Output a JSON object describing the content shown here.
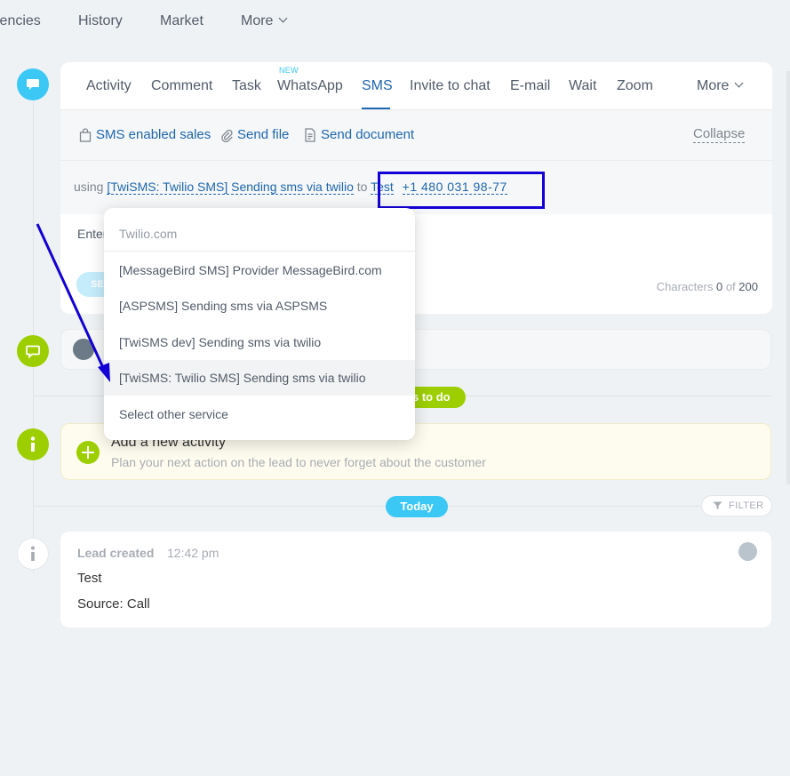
{
  "top_nav": {
    "items": [
      "lencies",
      "History",
      "Market",
      "More"
    ]
  },
  "composer": {
    "tabs": [
      "Activity",
      "Comment",
      "Task",
      "WhatsApp",
      "SMS",
      "Invite to chat",
      "E-mail",
      "Wait",
      "Zoom",
      "More"
    ],
    "new_badge": "NEW",
    "active_tab": "SMS",
    "toolbar": {
      "sms_enabled_sales": "SMS enabled sales",
      "send_file": "Send file",
      "send_document": "Send document",
      "collapse": "Collapse"
    },
    "using": {
      "prefix": "using",
      "service": "[TwiSMS: Twilio SMS] Sending sms via twilio",
      "to": "to",
      "contact": "Test",
      "phone": "+1 480 031 98-77"
    },
    "message_placeholder": "Enter",
    "send_label": "SE",
    "characters": {
      "label": "Characters",
      "count": "0",
      "of": "of",
      "max": "200"
    }
  },
  "service_dropdown": {
    "header": "Twilio.com",
    "items": [
      "[MessageBird SMS] Provider MessageBird.com",
      "[ASPSMS] Sending sms via ASPSMS",
      "[TwiSMS dev] Sending sms via twilio",
      "[TwiSMS: Twilio SMS] Sending sms via twilio",
      "Select other service"
    ],
    "selected": "[TwiSMS: Twilio SMS] Sending sms via twilio"
  },
  "timeline": {
    "todo_badge": "s to do",
    "new_activity": {
      "title": "Add a new activity",
      "subtitle": "Plan your next action on the lead to never forget about the customer"
    },
    "today_badge": "Today",
    "filter": "FILTER",
    "lead_created": {
      "title": "Lead created",
      "time": "12:42 pm",
      "lines": [
        "Test",
        "Source: Call"
      ]
    }
  },
  "colors": {
    "accent_blue": "#2067b0",
    "timeline_blue": "#3bc8f5",
    "timeline_green": "#9dcf00",
    "annotation_blue": "#1300d6"
  }
}
